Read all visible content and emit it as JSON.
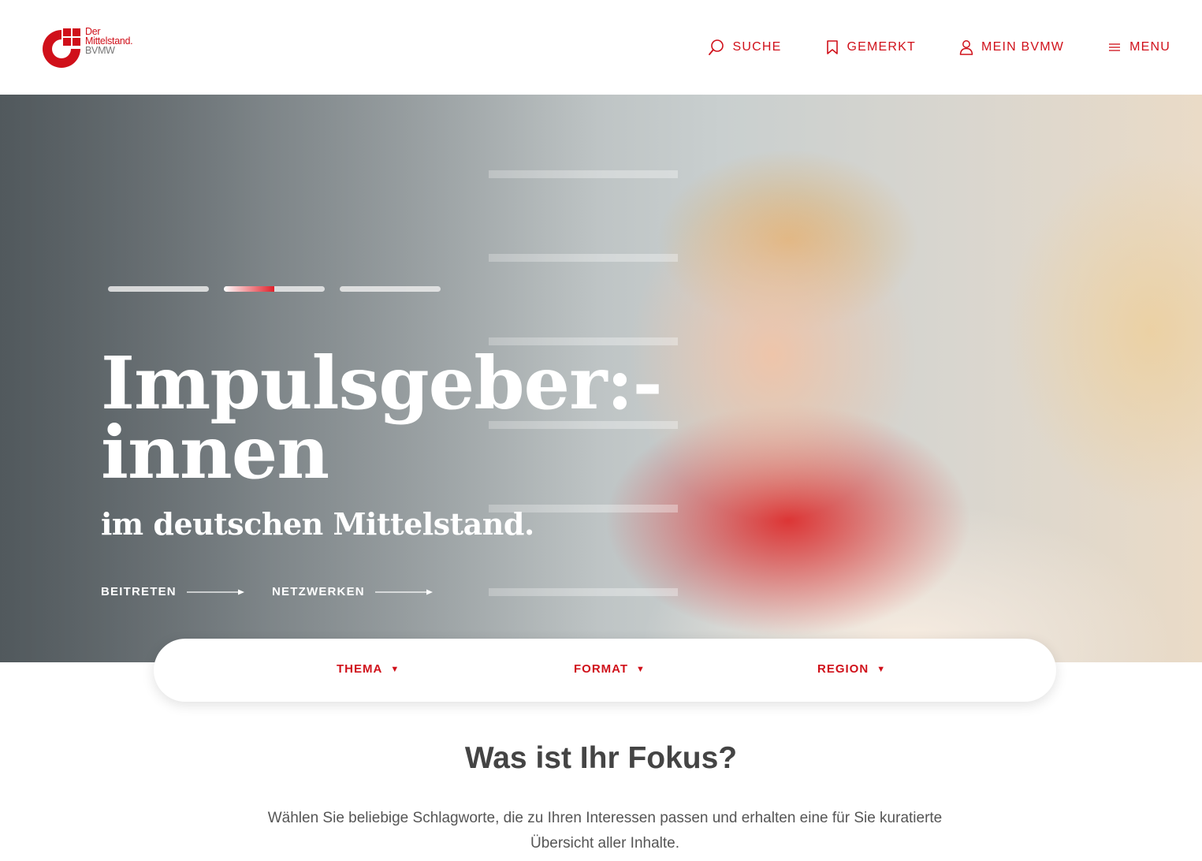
{
  "brand": {
    "logo_line1": "Der",
    "logo_line2": "Mittelstand.",
    "logo_line3": "BVMW",
    "accent_color": "#d0101a"
  },
  "nav": {
    "search": "SUCHE",
    "saved": "GEMERKT",
    "account": "MEIN BVMW",
    "menu": "MENU"
  },
  "hero": {
    "slides_total": 3,
    "active_slide": 2,
    "active_progress": 0.5,
    "headline_line1": "Impulsgeber:-",
    "headline_line2": "innen",
    "subline": "im deutschen Mittelstand.",
    "cta_join": "BEITRETEN",
    "cta_network": "NETZWERKEN"
  },
  "filters": [
    {
      "label": "THEMA"
    },
    {
      "label": "FORMAT"
    },
    {
      "label": "REGION"
    }
  ],
  "focus": {
    "title": "Was ist Ihr Fokus?",
    "text": "Wählen Sie beliebige Schlagworte, die zu Ihren Interessen passen und erhalten eine für Sie kuratierte Übersicht aller Inhalte."
  }
}
